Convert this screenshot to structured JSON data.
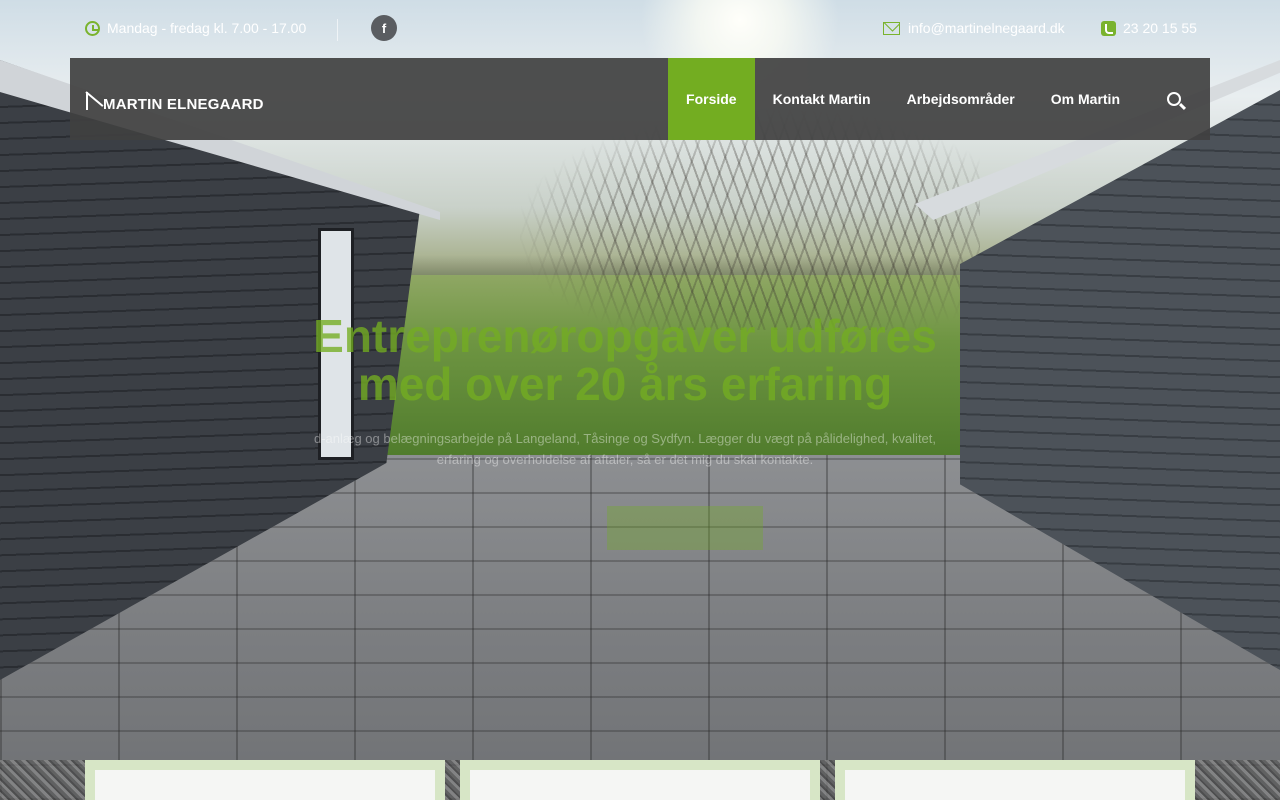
{
  "topbar": {
    "hours": "Mandag - fredag kl. 7.00 - 17.00",
    "facebook_glyph": "f",
    "email": "info@martinelnegaard.dk",
    "phone": "23 20 15 55",
    "icons": [
      "clock-icon",
      "facebook-icon",
      "mail-icon",
      "phone-icon"
    ]
  },
  "header": {
    "logo_text": "MARTIN ELNEGAARD",
    "menu": [
      {
        "label": "Forside",
        "active": true
      },
      {
        "label": "Kontakt Martin",
        "active": false
      },
      {
        "label": "Arbejdsområder",
        "active": false
      },
      {
        "label": "Om Martin",
        "active": false
      }
    ]
  },
  "hero": {
    "title": "Entreprenøropgaver udføres med over 20 års erfaring",
    "text": "d-anlæg og belægningsarbejde på Langeland, Tåsinge og Sydfyn. Lægger du vægt på pålidelighed, kvalitet, erfaring og overholdelse af aftaler, så er det mig du skal kontakte."
  },
  "colors": {
    "accent": "#73ad21",
    "nav_background": "#404040",
    "card_border": "#d7e6c6"
  }
}
